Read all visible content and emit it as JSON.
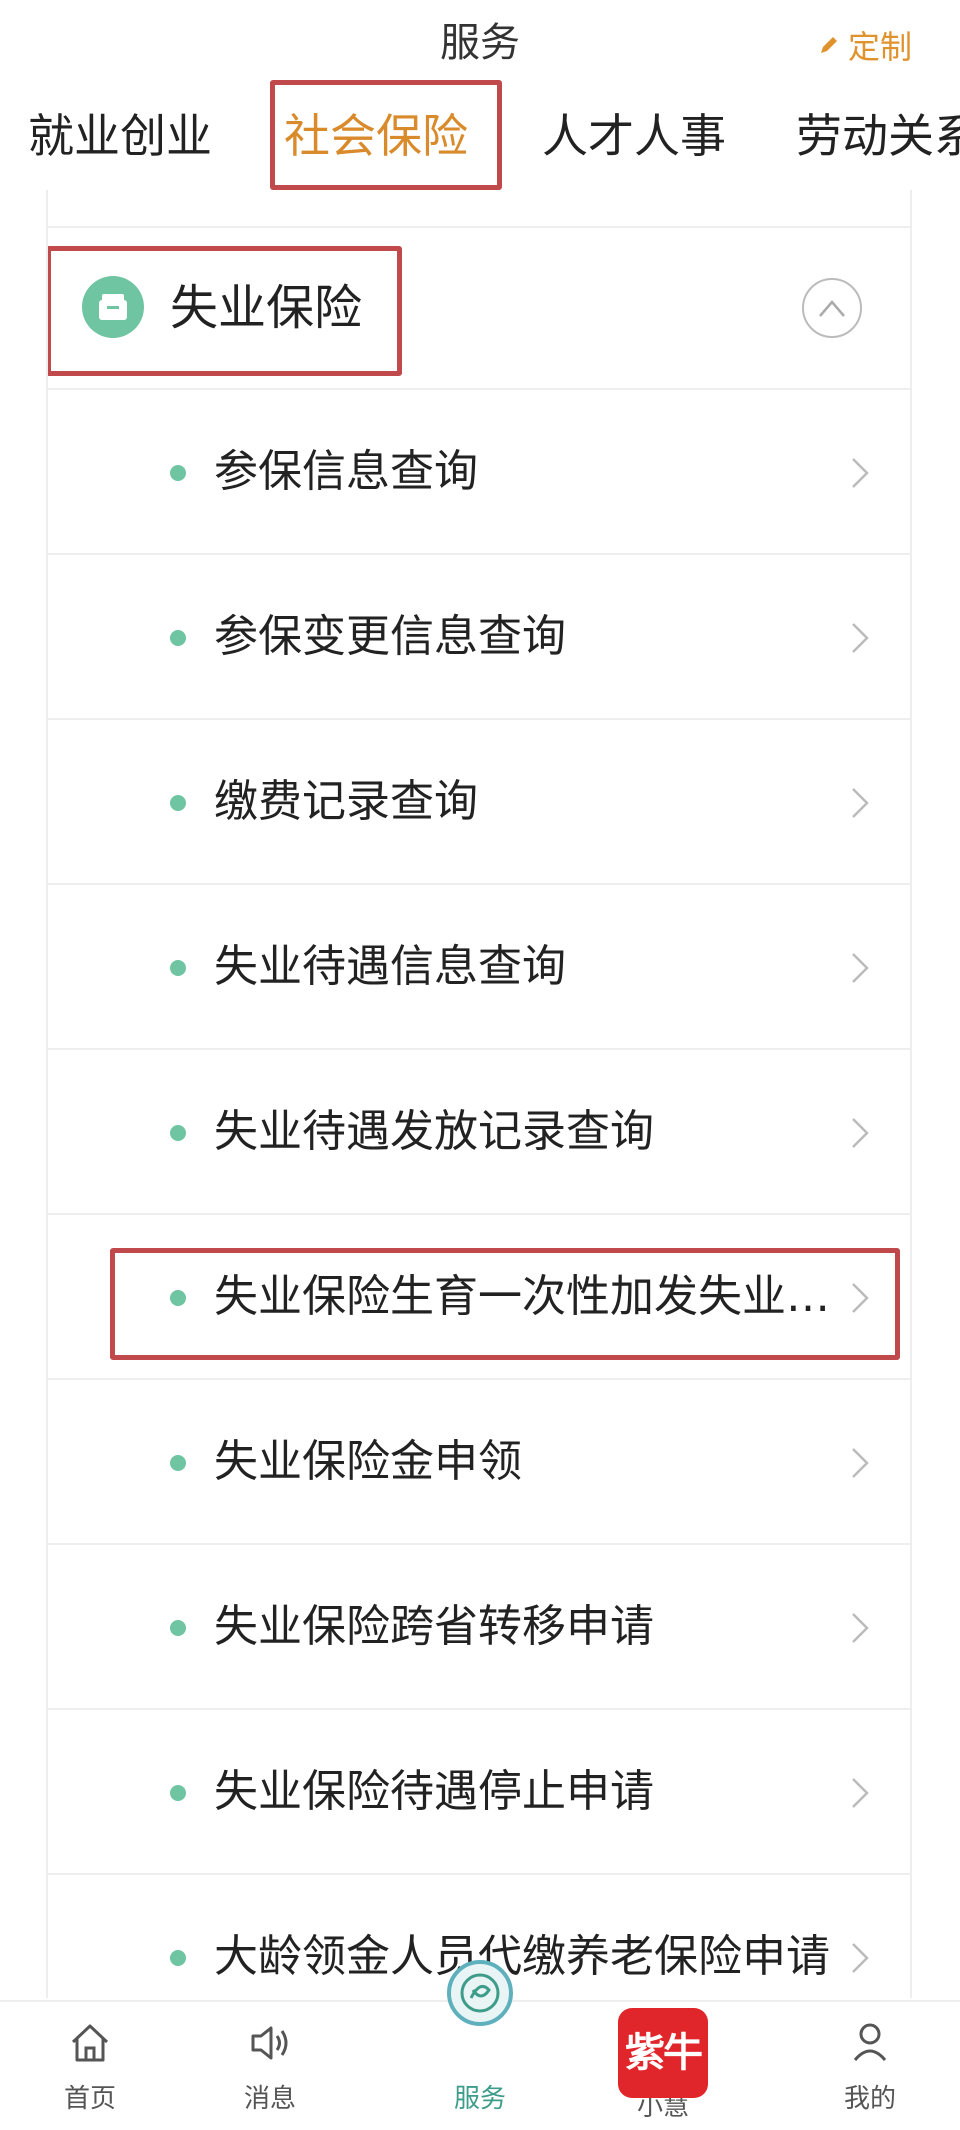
{
  "header": {
    "title": "服务",
    "customize_label": "定制"
  },
  "tabs": [
    {
      "label": "就业创业",
      "active": false
    },
    {
      "label": "社会保险",
      "active": true
    },
    {
      "label": "人才人事",
      "active": false
    },
    {
      "label": "劳动关系",
      "active": false
    }
  ],
  "section": {
    "title": "失业保险",
    "icon": "folder-icon",
    "expanded": true
  },
  "items": [
    {
      "label": "参保信息查询"
    },
    {
      "label": "参保变更信息查询"
    },
    {
      "label": "缴费记录查询"
    },
    {
      "label": "失业待遇信息查询"
    },
    {
      "label": "失业待遇发放记录查询"
    },
    {
      "label": "失业保险生育一次性加发失业保险金申领"
    },
    {
      "label": "失业保险金申领"
    },
    {
      "label": "失业保险跨省转移申请"
    },
    {
      "label": "失业保险待遇停止申请"
    },
    {
      "label": "大龄领金人员代缴养老保险申请"
    }
  ],
  "bottom_nav": [
    {
      "label": "首页",
      "icon": "home-icon"
    },
    {
      "label": "消息",
      "icon": "speaker-icon"
    },
    {
      "label": "服务",
      "icon": "service-logo-icon",
      "active": true
    },
    {
      "label": "小慧",
      "icon": "brand-logo-icon"
    },
    {
      "label": "我的",
      "icon": "user-icon"
    }
  ],
  "brand_logo_text": "紫牛",
  "colors": {
    "accent_orange": "#d98a2b",
    "dot_green": "#6fc4a1",
    "highlight_red": "#c0494c",
    "service_teal": "#3d9c8a",
    "brand_red": "#e0262b"
  }
}
